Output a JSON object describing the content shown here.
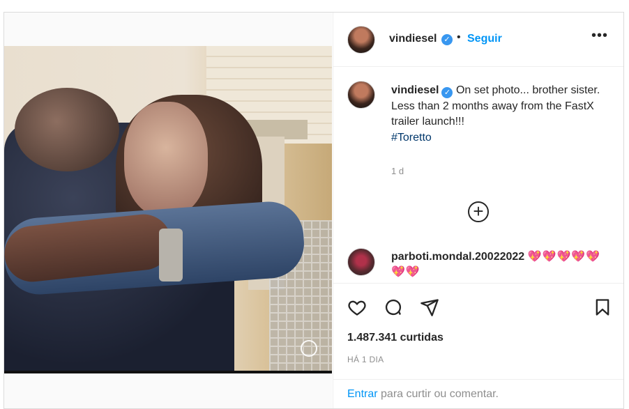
{
  "post": {
    "username": "vindiesel",
    "follow_label": "Seguir",
    "dot": "•",
    "more_label": "•••"
  },
  "caption": {
    "username": "vindiesel",
    "line1": "On set photo... brother sister.",
    "line2": "Less than 2 months away from the FastX trailer launch!!!",
    "hashtag": "#Toretto",
    "time": "1 d"
  },
  "load_more_label": "+",
  "comment": {
    "username": "parboti.mondal.20022022",
    "hearts": "💖💖💖💖💖💖💖"
  },
  "actions": [
    "like-icon",
    "comment-icon",
    "share-icon",
    "save-icon"
  ],
  "likes": "1.487.341 curtidas",
  "posted_ago": "HÁ 1 DIA",
  "footer": {
    "login_link": "Entrar",
    "rest": "para curtir ou comentar."
  },
  "colors": {
    "accent": "#0095f6",
    "verified": "#3897f0",
    "hashtag": "#00376b",
    "muted": "#8e8e8e"
  }
}
